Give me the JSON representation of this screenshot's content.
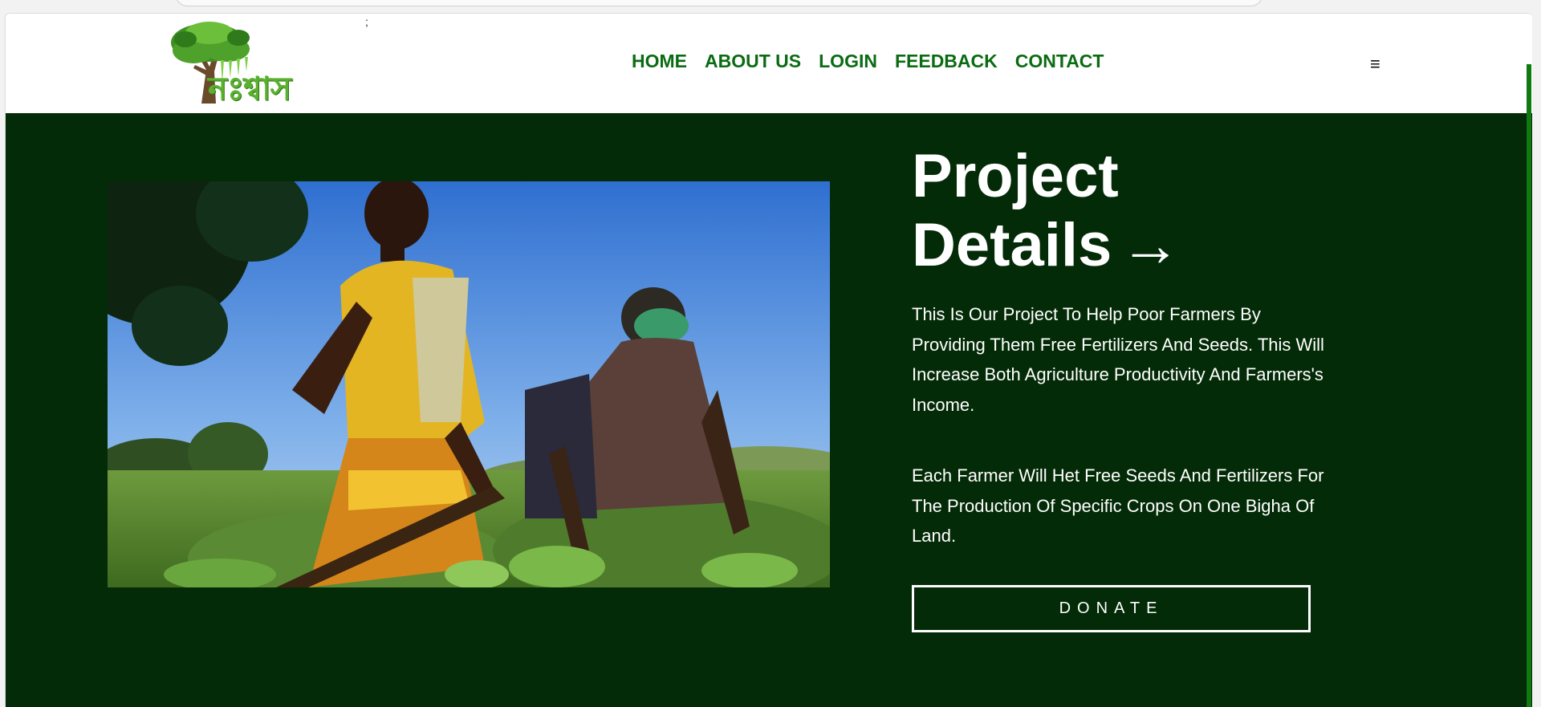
{
  "header": {
    "stray_char": ";",
    "logo_text": "নঃশ্বাস",
    "nav": [
      "HOME",
      "ABOUT US",
      "LOGIN",
      "FEEDBACK",
      "CONTACT"
    ],
    "menu_glyph": "≡"
  },
  "hero": {
    "title_line1": "Project",
    "title_line2": "Details",
    "arrow": "→",
    "paragraph1": "This Is Our Project To Help Poor Farmers By Providing Them Free Fertilizers And Seeds. This Will Increase Both Agriculture Productivity And Farmers's Income.",
    "paragraph2": "Each Farmer Will Het Free Seeds And Fertilizers For The Production Of Specific Crops On One Bigha Of Land.",
    "donate_label": "DONATE"
  },
  "colors": {
    "nav_green": "#0a6b12",
    "hero_bg": "#042b07",
    "accent": "#0f7a0f"
  },
  "icons": [
    "tree-logo-icon",
    "hamburger-menu-icon",
    "arrow-right-icon"
  ]
}
